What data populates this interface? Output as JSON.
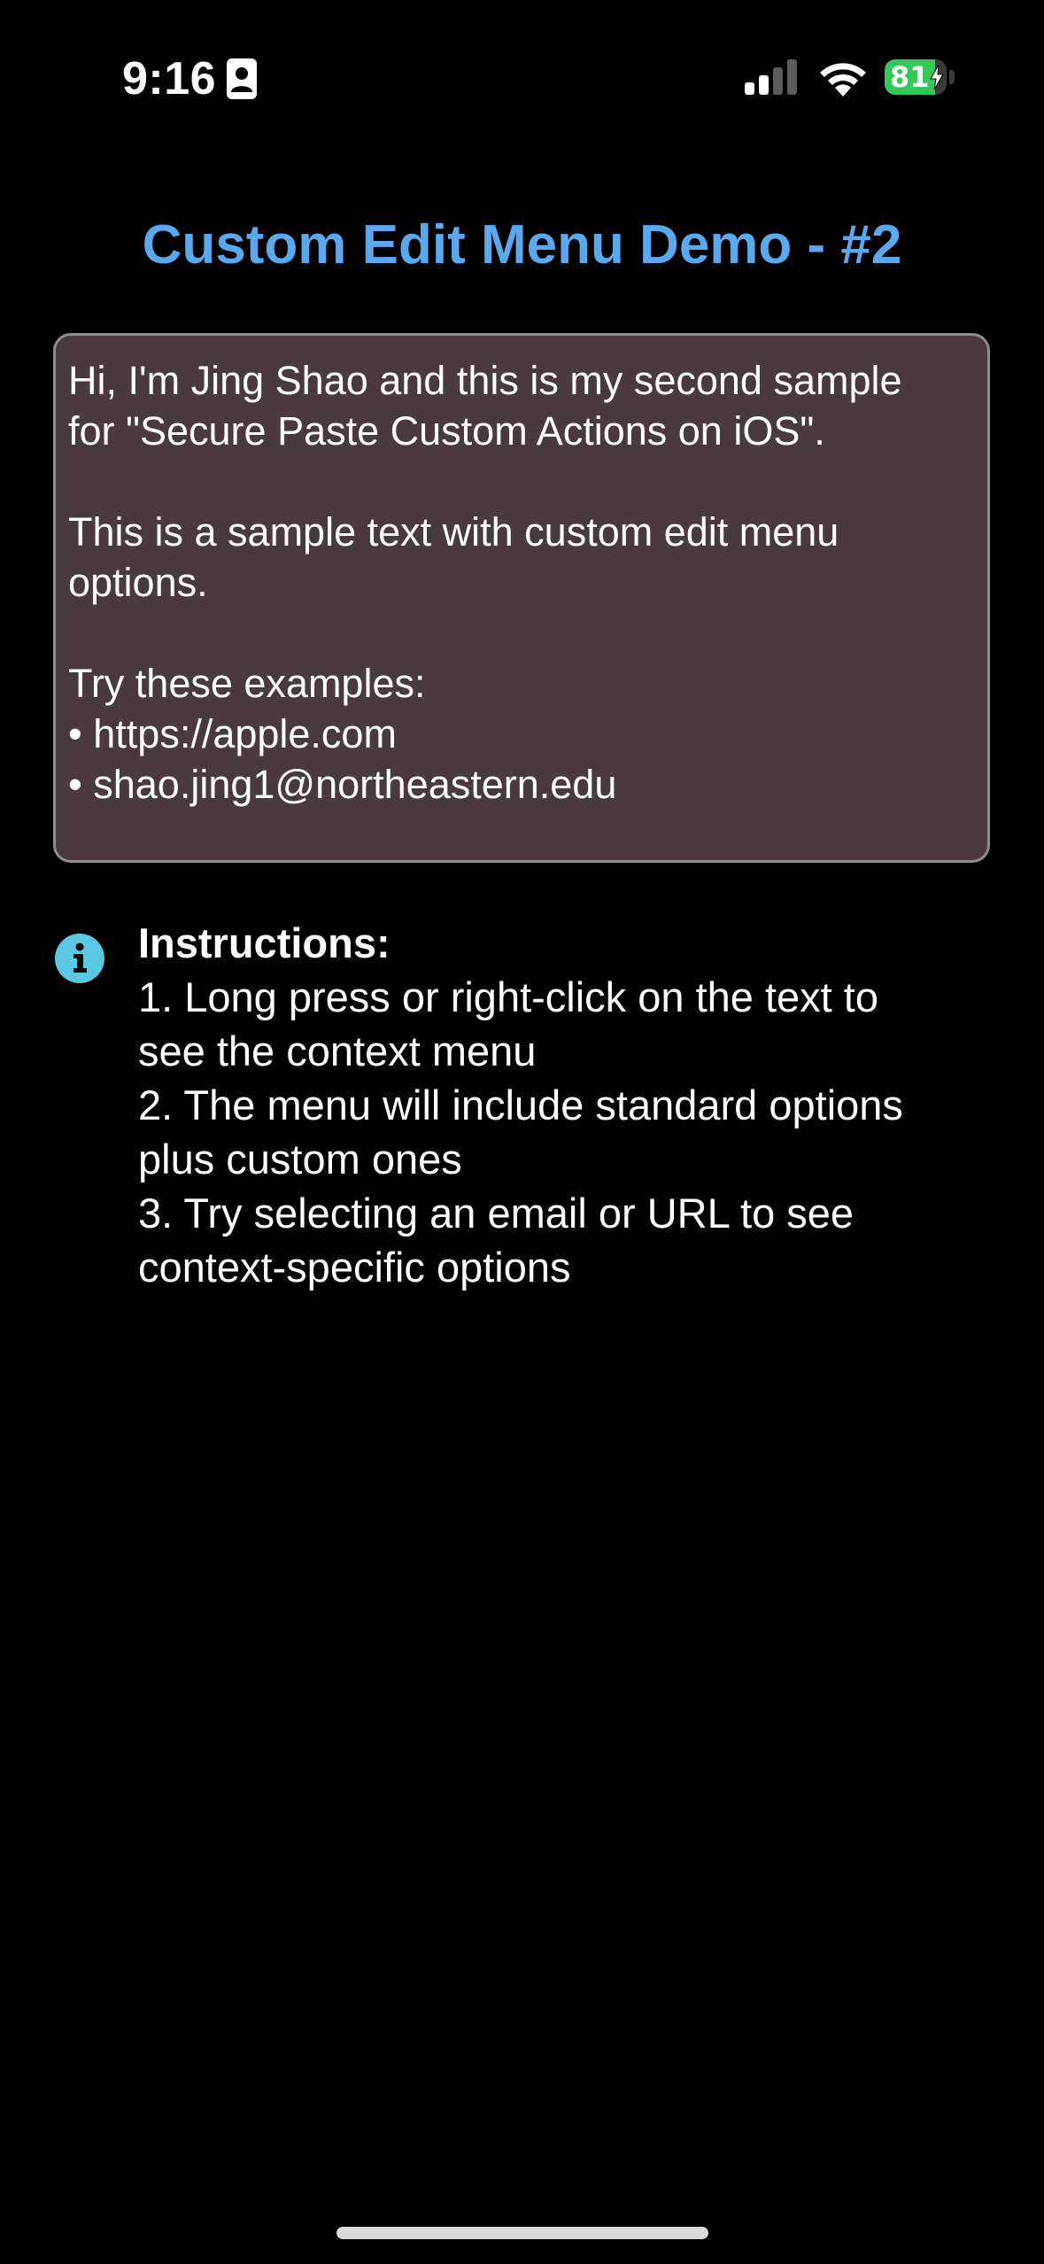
{
  "status_bar": {
    "time": "9:16",
    "battery_percent": "81",
    "battery_level": 0.81,
    "battery_color": "#34c759",
    "signal_bars_active": 2,
    "icons": [
      "contact-card-icon",
      "cellular-signal-icon",
      "wifi-icon",
      "battery-charging-icon"
    ]
  },
  "page": {
    "title": "Custom Edit Menu Demo - #2",
    "title_color": "#5aa9ee"
  },
  "sample_text": {
    "background": "#4a393e",
    "lines": [
      "Hi, I'm Jing Shao and this is my second sample",
      "for \"Secure Paste Custom Actions on iOS\".",
      "This is a sample text with custom edit menu",
      "options.",
      "Try these examples:",
      "• https://apple.com",
      "• shao.jing1@northeastern.edu"
    ]
  },
  "instructions": {
    "icon": "info-icon",
    "icon_color": "#5ac8e0",
    "title": "Instructions:",
    "steps": [
      "1. Long press or right-click on the text to",
      "see the context menu",
      "2. The menu will include standard options",
      "plus custom ones",
      "3. Try selecting an email or URL to see",
      "context-specific options"
    ]
  }
}
